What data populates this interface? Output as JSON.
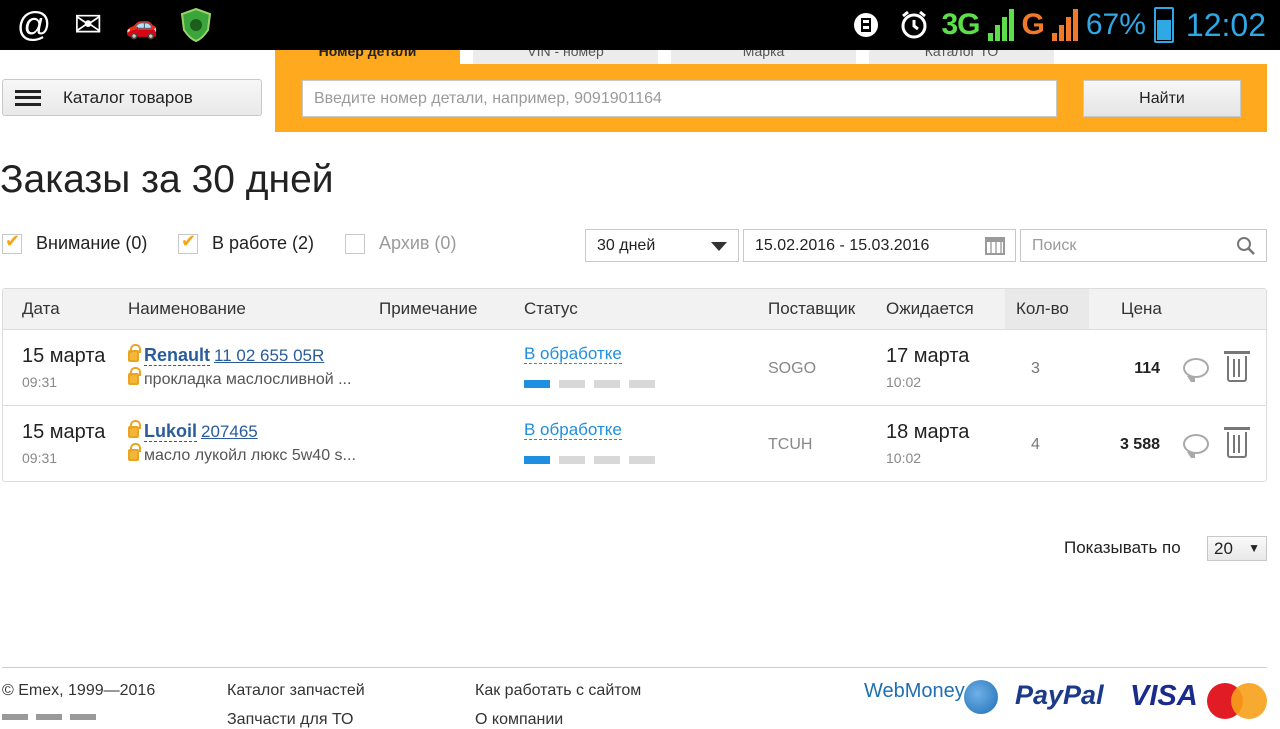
{
  "statusbar": {
    "time": "12:02",
    "battery_pct": "67%",
    "net_primary": "3G",
    "net_secondary": "G",
    "icons": [
      "at-icon",
      "mail-icon",
      "car-lock-icon",
      "shield-icon",
      "vpn-icon",
      "alarm-icon",
      "battery-icon"
    ]
  },
  "header": {
    "catalog_label": "Каталог товаров",
    "tabs": [
      "Номер детали",
      "VIN - номер",
      "Марка",
      "Каталог ТО"
    ],
    "search_placeholder": "Введите номер детали, например, 9091901164",
    "find_label": "Найти"
  },
  "page": {
    "title": "Заказы за 30 дней"
  },
  "filters": {
    "attention": "Внимание (0)",
    "in_work": "В работе (2)",
    "archive": "Архив (0)",
    "period": "30 дней",
    "date_range": "15.02.2016 - 15.03.2016",
    "search_placeholder": "Поиск"
  },
  "table": {
    "headers": {
      "date": "Дата",
      "name": "Наименование",
      "note": "Примечание",
      "status": "Статус",
      "supplier": "Поставщик",
      "expected": "Ожидается",
      "qty": "Кол-во",
      "price": "Цена"
    },
    "rows": [
      {
        "date": "15 марта",
        "time": "09:31",
        "brand": "Renault",
        "part_no": "11 02 655 05R",
        "desc": "прокладка маслосливной ...",
        "status": "В обработке",
        "progress_steps_done": 1,
        "progress_steps_total": 4,
        "supplier": "SOGO",
        "expected_date": "17 марта",
        "expected_time": "10:02",
        "qty": "3",
        "price": "114"
      },
      {
        "date": "15 марта",
        "time": "09:31",
        "brand": "Lukoil",
        "part_no": "207465",
        "desc": "масло лукойл люкс 5w40 s...",
        "status": "В обработке",
        "progress_steps_done": 1,
        "progress_steps_total": 4,
        "supplier": "TCUH",
        "expected_date": "18 марта",
        "expected_time": "10:02",
        "qty": "4",
        "price": "3 588"
      }
    ]
  },
  "pagination": {
    "label": "Показывать по",
    "per_page": "20"
  },
  "footer": {
    "copyright": "© Emex, 1999—2016",
    "link1": "Каталог запчастей",
    "link2": "Как работать с сайтом",
    "link1_cut": "Запчасти для ТО",
    "link2_cut": "О компании",
    "payments": {
      "webmoney": "WebMoney",
      "paypal": "PayPal",
      "visa": "VISA",
      "mastercard": "MasterCard"
    }
  }
}
